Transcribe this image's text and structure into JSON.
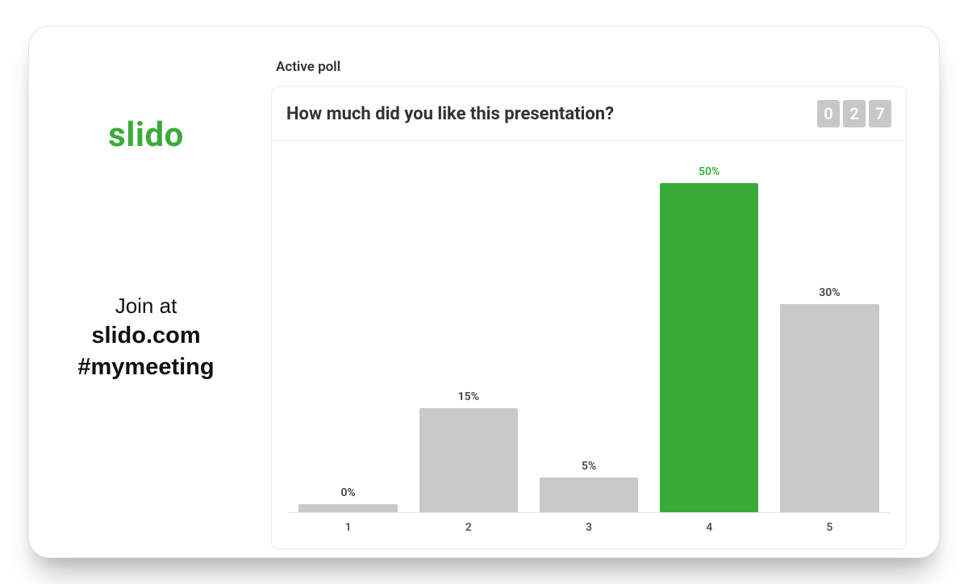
{
  "colors": {
    "accent": "#39ac37",
    "bar_grey": "#c9c9c9"
  },
  "sidebar": {
    "logo_text": "slido",
    "join_line1": "Join at",
    "join_line2": "slido.com",
    "join_line3": "#mymeeting"
  },
  "main": {
    "section_label": "Active poll",
    "question": "How much did you like this presentation?",
    "counter_digits": [
      "0",
      "2",
      "7"
    ]
  },
  "chart_data": {
    "type": "bar",
    "title": "How much did you like this presentation?",
    "xlabel": "",
    "ylabel": "",
    "ylim": [
      0,
      50
    ],
    "categories": [
      "1",
      "2",
      "3",
      "4",
      "5"
    ],
    "values": [
      0,
      15,
      5,
      50,
      30
    ],
    "value_labels": [
      "0%",
      "15%",
      "5%",
      "50%",
      "30%"
    ],
    "highlight_index": 3
  }
}
